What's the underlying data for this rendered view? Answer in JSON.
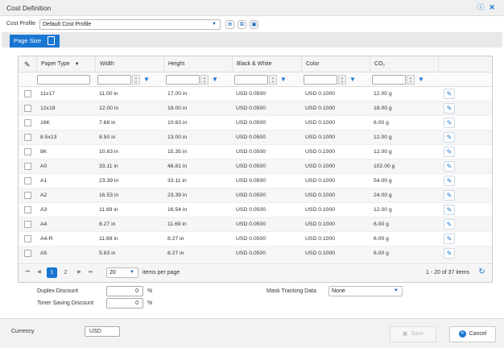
{
  "window": {
    "title": "Cost Definition",
    "help_icon": "help-circle-icon",
    "close_icon": "close-icon"
  },
  "profile": {
    "label": "Cost Profile",
    "selected": "Default Cost Profile",
    "add_icon": "add-circle-icon",
    "copy_icon": "copy-icon",
    "delete_icon": "trash-icon"
  },
  "tab": {
    "label": "Page Size",
    "icon": "document-icon"
  },
  "grid": {
    "columns": [
      "Paper Type",
      "Width",
      "Height",
      "Black & White",
      "Color",
      "CO₂"
    ],
    "sort_indicator": "▾",
    "rows": [
      {
        "paper": "11x17",
        "width": "11.00 in",
        "height": "17.00 in",
        "bw": "USD 0.0500",
        "color": "USD 0.1000",
        "co2": "12.00 g"
      },
      {
        "paper": "12x18",
        "width": "12.00 in",
        "height": "18.00 in",
        "bw": "USD 0.0500",
        "color": "USD 0.1000",
        "co2": "18.00 g"
      },
      {
        "paper": "16K",
        "width": "7.68 in",
        "height": "10.63 in",
        "bw": "USD 0.0500",
        "color": "USD 0.1000",
        "co2": "6.00 g"
      },
      {
        "paper": "8.5x13",
        "width": "8.50 in",
        "height": "13.00 in",
        "bw": "USD 0.0500",
        "color": "USD 0.1000",
        "co2": "12.00 g"
      },
      {
        "paper": "8K",
        "width": "10.63 in",
        "height": "15.35 in",
        "bw": "USD 0.0500",
        "color": "USD 0.1000",
        "co2": "12.00 g"
      },
      {
        "paper": "A0",
        "width": "33.11 in",
        "height": "46.81 in",
        "bw": "USD 0.0500",
        "color": "USD 0.1000",
        "co2": "102.00 g"
      },
      {
        "paper": "A1",
        "width": "23.39 in",
        "height": "33.11 in",
        "bw": "USD 0.0500",
        "color": "USD 0.1000",
        "co2": "54.00 g"
      },
      {
        "paper": "A2",
        "width": "16.53 in",
        "height": "23.39 in",
        "bw": "USD 0.0500",
        "color": "USD 0.1000",
        "co2": "24.00 g"
      },
      {
        "paper": "A3",
        "width": "11.69 in",
        "height": "16.54 in",
        "bw": "USD 0.0500",
        "color": "USD 0.1000",
        "co2": "12.00 g"
      },
      {
        "paper": "A4",
        "width": "8.27 in",
        "height": "11.69 in",
        "bw": "USD 0.0500",
        "color": "USD 0.1000",
        "co2": "6.00 g"
      },
      {
        "paper": "A4-R",
        "width": "11.69 in",
        "height": "8.27 in",
        "bw": "USD 0.0500",
        "color": "USD 0.1000",
        "co2": "6.00 g"
      },
      {
        "paper": "A5",
        "width": "5.83 in",
        "height": "8.27 in",
        "bw": "USD 0.0500",
        "color": "USD 0.1000",
        "co2": "6.00 g"
      }
    ]
  },
  "pager": {
    "pages": [
      "1",
      "2"
    ],
    "page_size": "20",
    "page_size_label": "items per page",
    "summary": "1 - 20 of 37 items"
  },
  "options": {
    "duplex_label": "Duplex Discount",
    "duplex_value": "0",
    "toner_label": "Toner Saving Discount",
    "toner_value": "0",
    "percent": "%",
    "mask_label": "Mask Tracking Data",
    "mask_value": "None"
  },
  "footer": {
    "currency_label": "Currency",
    "currency_value": "USD",
    "save_label": "Save",
    "cancel_label": "Cancel"
  },
  "colors": {
    "accent": "#1976d2"
  }
}
